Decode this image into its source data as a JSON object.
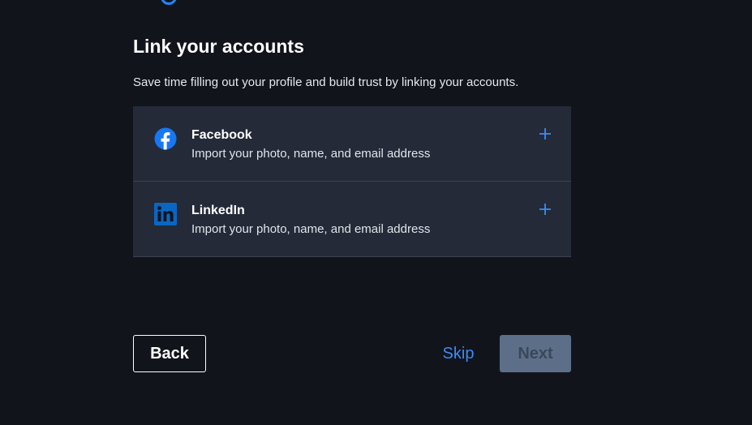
{
  "header": {
    "title": "Link your accounts",
    "subtitle": "Save time filling out your profile and build trust by linking your accounts."
  },
  "accounts": [
    {
      "name": "Facebook",
      "description": "Import your photo, name, and email address",
      "icon": "facebook-icon",
      "icon_color": "#1877f2"
    },
    {
      "name": "LinkedIn",
      "description": "Import your photo, name, and email address",
      "icon": "linkedin-icon",
      "icon_color": "#0a66c2"
    }
  ],
  "footer": {
    "back_label": "Back",
    "skip_label": "Skip",
    "next_label": "Next"
  },
  "colors": {
    "background": "#12141c",
    "card": "#242a38",
    "accent": "#3b8cf5",
    "disabled_button": "#5d6f88"
  }
}
